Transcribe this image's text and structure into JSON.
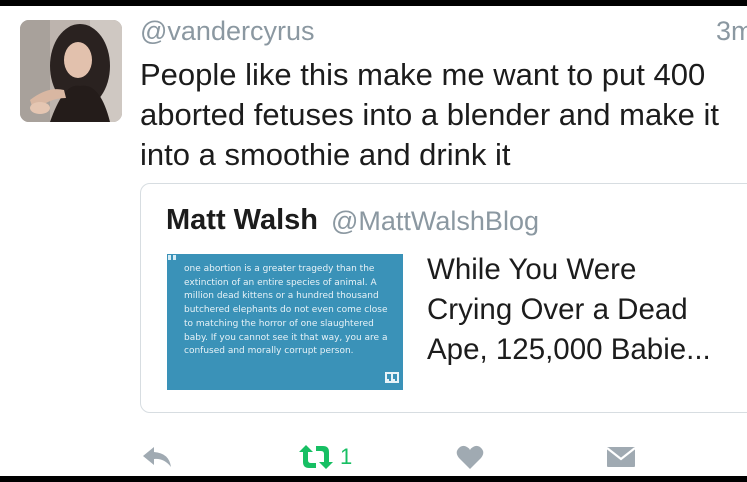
{
  "tweet": {
    "handle": "@vandercyrus",
    "time": "3m",
    "text": "People like this make me want to put 400\naborted fetuses into a blender and make it\ninto a smoothie and drink it"
  },
  "quoted_tweet": {
    "author_name": "Matt Walsh",
    "author_handle": "@MattWalshBlog",
    "image_text": "one abortion is a greater tragedy than the extinction of an entire species of animal. A million dead kittens or a hundred thousand butchered elephants do not even come close to matching the horror of one slaughtered baby. If you cannot see it that way, you are a confused and morally corrupt person.",
    "title": "While You Were\nCrying Over a Dead\nApe, 125,000 Babie..."
  },
  "actions": {
    "reply_icon": "reply-icon",
    "retweet_icon": "retweet-icon",
    "retweet_count": "1",
    "like_icon": "heart-icon",
    "dm_icon": "envelope-icon"
  },
  "colors": {
    "muted_text": "#8b98a1",
    "retweet_active": "#17bf63",
    "image_background": "#3a92b8",
    "border": "#d7dde1"
  }
}
